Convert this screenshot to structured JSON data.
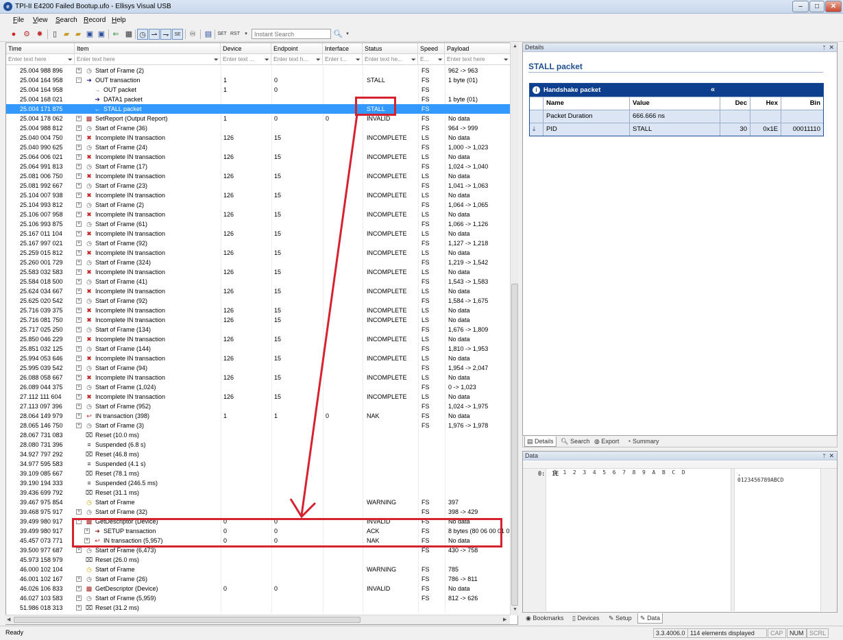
{
  "window": {
    "title": "TPI-II E4200 Failed Bootup.ufo - Ellisys Visual USB",
    "app_icon": "ellisys-logo-icon"
  },
  "menu": [
    {
      "key": "F",
      "rest": "ile"
    },
    {
      "key": "V",
      "rest": "iew"
    },
    {
      "key": "S",
      "rest": "earch"
    },
    {
      "key": "R",
      "rest": "ecord"
    },
    {
      "key": "H",
      "rest": "elp"
    }
  ],
  "toolbar": {
    "search_placeholder": "Instant Search"
  },
  "columns": {
    "time": "Time",
    "item": "Item",
    "device": "Device",
    "endpoint": "Endpoint",
    "interface": "Interface",
    "status": "Status",
    "speed": "Speed",
    "payload": "Payload"
  },
  "filters": {
    "time": "Enter text here",
    "item": "Enter text here",
    "device": "Enter text ...",
    "endpoint": "Enter text h...",
    "interface": "Enter t...",
    "status": "Enter text he...",
    "speed": "E...",
    "payload": "Enter text here"
  },
  "rows": [
    {
      "time": "25.004 988 896",
      "indent": 0,
      "exp": "+",
      "icon": "sof",
      "item": "Start of Frame (2)",
      "dev": "",
      "ep": "",
      "iface": "",
      "status": "",
      "speed": "FS",
      "payload": "962 -> 963"
    },
    {
      "time": "25.004 164 958",
      "indent": 0,
      "exp": "-",
      "icon": "out",
      "item": "OUT transaction",
      "dev": "1",
      "ep": "0",
      "iface": "",
      "status": "STALL",
      "speed": "FS",
      "payload": "1 byte (01)"
    },
    {
      "time": "25.004 164 958",
      "indent": 1,
      "exp": "",
      "icon": "outpkt",
      "item": "OUT packet",
      "dev": "1",
      "ep": "0",
      "iface": "",
      "status": "",
      "speed": "FS",
      "payload": ""
    },
    {
      "time": "25.004 168 021",
      "indent": 1,
      "exp": "",
      "icon": "data",
      "item": "DATA1 packet",
      "dev": "",
      "ep": "",
      "iface": "",
      "status": "",
      "speed": "FS",
      "payload": "1 byte (01)"
    },
    {
      "time": "25.004 171 875",
      "indent": 1,
      "exp": "",
      "icon": "stall",
      "item": "STALL packet",
      "dev": "",
      "ep": "",
      "iface": "",
      "status": "STALL",
      "speed": "FS",
      "payload": "",
      "selected": true
    },
    {
      "time": "25.004 178 062",
      "indent": 0,
      "exp": "+",
      "icon": "bad",
      "item": "SetReport (Output Report)",
      "dev": "1",
      "ep": "0",
      "iface": "0",
      "status": "INVALID",
      "speed": "FS",
      "payload": "No data"
    },
    {
      "time": "25.004 988 812",
      "indent": 0,
      "exp": "+",
      "icon": "sof",
      "item": "Start of Frame (36)",
      "dev": "",
      "ep": "",
      "iface": "",
      "status": "",
      "speed": "FS",
      "payload": "964 -> 999"
    },
    {
      "time": "25.040 004 750",
      "indent": 0,
      "exp": "+",
      "icon": "x",
      "item": "Incomplete IN transaction",
      "dev": "126",
      "ep": "15",
      "iface": "",
      "status": "INCOMPLETE",
      "speed": "LS",
      "payload": "No data"
    },
    {
      "time": "25.040 990 625",
      "indent": 0,
      "exp": "+",
      "icon": "sof",
      "item": "Start of Frame (24)",
      "dev": "",
      "ep": "",
      "iface": "",
      "status": "",
      "speed": "FS",
      "payload": "1,000 -> 1,023"
    },
    {
      "time": "25.064 006 021",
      "indent": 0,
      "exp": "+",
      "icon": "x",
      "item": "Incomplete IN transaction",
      "dev": "126",
      "ep": "15",
      "iface": "",
      "status": "INCOMPLETE",
      "speed": "LS",
      "payload": "No data"
    },
    {
      "time": "25.064 991 813",
      "indent": 0,
      "exp": "+",
      "icon": "sof",
      "item": "Start of Frame (17)",
      "dev": "",
      "ep": "",
      "iface": "",
      "status": "",
      "speed": "FS",
      "payload": "1,024 -> 1,040"
    },
    {
      "time": "25.081 006 750",
      "indent": 0,
      "exp": "+",
      "icon": "x",
      "item": "Incomplete IN transaction",
      "dev": "126",
      "ep": "15",
      "iface": "",
      "status": "INCOMPLETE",
      "speed": "LS",
      "payload": "No data"
    },
    {
      "time": "25.081 992 667",
      "indent": 0,
      "exp": "+",
      "icon": "sof",
      "item": "Start of Frame (23)",
      "dev": "",
      "ep": "",
      "iface": "",
      "status": "",
      "speed": "FS",
      "payload": "1,041 -> 1,063"
    },
    {
      "time": "25.104 007 938",
      "indent": 0,
      "exp": "+",
      "icon": "x",
      "item": "Incomplete IN transaction",
      "dev": "126",
      "ep": "15",
      "iface": "",
      "status": "INCOMPLETE",
      "speed": "LS",
      "payload": "No data"
    },
    {
      "time": "25.104 993 812",
      "indent": 0,
      "exp": "+",
      "icon": "sof",
      "item": "Start of Frame (2)",
      "dev": "",
      "ep": "",
      "iface": "",
      "status": "",
      "speed": "FS",
      "payload": "1,064 -> 1,065"
    },
    {
      "time": "25.106 007 958",
      "indent": 0,
      "exp": "+",
      "icon": "x",
      "item": "Incomplete IN transaction",
      "dev": "126",
      "ep": "15",
      "iface": "",
      "status": "INCOMPLETE",
      "speed": "LS",
      "payload": "No data"
    },
    {
      "time": "25.106 993 875",
      "indent": 0,
      "exp": "+",
      "icon": "sof",
      "item": "Start of Frame (61)",
      "dev": "",
      "ep": "",
      "iface": "",
      "status": "",
      "speed": "FS",
      "payload": "1,066 -> 1,126"
    },
    {
      "time": "25.167 011 104",
      "indent": 0,
      "exp": "+",
      "icon": "x",
      "item": "Incomplete IN transaction",
      "dev": "126",
      "ep": "15",
      "iface": "",
      "status": "INCOMPLETE",
      "speed": "LS",
      "payload": "No data"
    },
    {
      "time": "25.167 997 021",
      "indent": 0,
      "exp": "+",
      "icon": "sof",
      "item": "Start of Frame (92)",
      "dev": "",
      "ep": "",
      "iface": "",
      "status": "",
      "speed": "FS",
      "payload": "1,127 -> 1,218"
    },
    {
      "time": "25.259 015 812",
      "indent": 0,
      "exp": "+",
      "icon": "x",
      "item": "Incomplete IN transaction",
      "dev": "126",
      "ep": "15",
      "iface": "",
      "status": "INCOMPLETE",
      "speed": "LS",
      "payload": "No data"
    },
    {
      "time": "25.260 001 729",
      "indent": 0,
      "exp": "+",
      "icon": "sof",
      "item": "Start of Frame (324)",
      "dev": "",
      "ep": "",
      "iface": "",
      "status": "",
      "speed": "FS",
      "payload": "1,219 -> 1,542"
    },
    {
      "time": "25.583 032 583",
      "indent": 0,
      "exp": "+",
      "icon": "x",
      "item": "Incomplete IN transaction",
      "dev": "126",
      "ep": "15",
      "iface": "",
      "status": "INCOMPLETE",
      "speed": "LS",
      "payload": "No data"
    },
    {
      "time": "25.584 018 500",
      "indent": 0,
      "exp": "+",
      "icon": "sof",
      "item": "Start of Frame (41)",
      "dev": "",
      "ep": "",
      "iface": "",
      "status": "",
      "speed": "FS",
      "payload": "1,543 -> 1,583"
    },
    {
      "time": "25.624 034 667",
      "indent": 0,
      "exp": "+",
      "icon": "x",
      "item": "Incomplete IN transaction",
      "dev": "126",
      "ep": "15",
      "iface": "",
      "status": "INCOMPLETE",
      "speed": "LS",
      "payload": "No data"
    },
    {
      "time": "25.625 020 542",
      "indent": 0,
      "exp": "+",
      "icon": "sof",
      "item": "Start of Frame (92)",
      "dev": "",
      "ep": "",
      "iface": "",
      "status": "",
      "speed": "FS",
      "payload": "1,584 -> 1,675"
    },
    {
      "time": "25.716 039 375",
      "indent": 0,
      "exp": "+",
      "icon": "x",
      "item": "Incomplete IN transaction",
      "dev": "126",
      "ep": "15",
      "iface": "",
      "status": "INCOMPLETE",
      "speed": "LS",
      "payload": "No data"
    },
    {
      "time": "25.716 081 750",
      "indent": 0,
      "exp": "+",
      "icon": "x",
      "item": "Incomplete IN transaction",
      "dev": "126",
      "ep": "15",
      "iface": "",
      "status": "INCOMPLETE",
      "speed": "LS",
      "payload": "No data"
    },
    {
      "time": "25.717 025 250",
      "indent": 0,
      "exp": "+",
      "icon": "sof",
      "item": "Start of Frame (134)",
      "dev": "",
      "ep": "",
      "iface": "",
      "status": "",
      "speed": "FS",
      "payload": "1,676 -> 1,809"
    },
    {
      "time": "25.850 046 229",
      "indent": 0,
      "exp": "+",
      "icon": "x",
      "item": "Incomplete IN transaction",
      "dev": "126",
      "ep": "15",
      "iface": "",
      "status": "INCOMPLETE",
      "speed": "LS",
      "payload": "No data"
    },
    {
      "time": "25.851 032 125",
      "indent": 0,
      "exp": "+",
      "icon": "sof",
      "item": "Start of Frame (144)",
      "dev": "",
      "ep": "",
      "iface": "",
      "status": "",
      "speed": "FS",
      "payload": "1,810 -> 1,953"
    },
    {
      "time": "25.994 053 646",
      "indent": 0,
      "exp": "+",
      "icon": "x",
      "item": "Incomplete IN transaction",
      "dev": "126",
      "ep": "15",
      "iface": "",
      "status": "INCOMPLETE",
      "speed": "LS",
      "payload": "No data"
    },
    {
      "time": "25.995 039 542",
      "indent": 0,
      "exp": "+",
      "icon": "sof",
      "item": "Start of Frame (94)",
      "dev": "",
      "ep": "",
      "iface": "",
      "status": "",
      "speed": "FS",
      "payload": "1,954 -> 2,047"
    },
    {
      "time": "26.088 058 667",
      "indent": 0,
      "exp": "+",
      "icon": "x",
      "item": "Incomplete IN transaction",
      "dev": "126",
      "ep": "15",
      "iface": "",
      "status": "INCOMPLETE",
      "speed": "LS",
      "payload": "No data"
    },
    {
      "time": "26.089 044 375",
      "indent": 0,
      "exp": "+",
      "icon": "sof",
      "item": "Start of Frame (1,024)",
      "dev": "",
      "ep": "",
      "iface": "",
      "status": "",
      "speed": "FS",
      "payload": "0 -> 1,023"
    },
    {
      "time": "27.112 111 604",
      "indent": 0,
      "exp": "+",
      "icon": "x",
      "item": "Incomplete IN transaction",
      "dev": "126",
      "ep": "15",
      "iface": "",
      "status": "INCOMPLETE",
      "speed": "LS",
      "payload": "No data"
    },
    {
      "time": "27.113 097 396",
      "indent": 0,
      "exp": "+",
      "icon": "sof",
      "item": "Start of Frame (952)",
      "dev": "",
      "ep": "",
      "iface": "",
      "status": "",
      "speed": "FS",
      "payload": "1,024 -> 1,975"
    },
    {
      "time": "28.064 149 979",
      "indent": 0,
      "exp": "+",
      "icon": "in",
      "item": "IN transaction (398)",
      "dev": "1",
      "ep": "1",
      "iface": "0",
      "status": "NAK",
      "speed": "FS",
      "payload": "No data"
    },
    {
      "time": "28.065 146 750",
      "indent": 0,
      "exp": "+",
      "icon": "sof",
      "item": "Start of Frame (3)",
      "dev": "",
      "ep": "",
      "iface": "",
      "status": "",
      "speed": "FS",
      "payload": "1,976 -> 1,978"
    },
    {
      "time": "28.067 731 083",
      "indent": 0,
      "exp": "",
      "icon": "reset",
      "item": "Reset (10.0 ms)",
      "dev": "",
      "ep": "",
      "iface": "",
      "status": "",
      "speed": "",
      "payload": ""
    },
    {
      "time": "28.080 731 396",
      "indent": 0,
      "exp": "",
      "icon": "idle",
      "item": "Suspended (6.8 s)",
      "dev": "",
      "ep": "",
      "iface": "",
      "status": "",
      "speed": "",
      "payload": ""
    },
    {
      "time": "34.927 797 292",
      "indent": 0,
      "exp": "",
      "icon": "reset",
      "item": "Reset (46.8 ms)",
      "dev": "",
      "ep": "",
      "iface": "",
      "status": "",
      "speed": "",
      "payload": ""
    },
    {
      "time": "34.977 595 583",
      "indent": 0,
      "exp": "",
      "icon": "idle",
      "item": "Suspended (4.1 s)",
      "dev": "",
      "ep": "",
      "iface": "",
      "status": "",
      "speed": "",
      "payload": ""
    },
    {
      "time": "39.109 085 667",
      "indent": 0,
      "exp": "",
      "icon": "reset",
      "item": "Reset (78.1 ms)",
      "dev": "",
      "ep": "",
      "iface": "",
      "status": "",
      "speed": "",
      "payload": ""
    },
    {
      "time": "39.190 194 333",
      "indent": 0,
      "exp": "",
      "icon": "idle",
      "item": "Suspended (246.5 ms)",
      "dev": "",
      "ep": "",
      "iface": "",
      "status": "",
      "speed": "",
      "payload": ""
    },
    {
      "time": "39.436 699 792",
      "indent": 0,
      "exp": "",
      "icon": "reset",
      "item": "Reset (31.1 ms)",
      "dev": "",
      "ep": "",
      "iface": "",
      "status": "",
      "speed": "",
      "payload": ""
    },
    {
      "time": "39.467 975 854",
      "indent": 0,
      "exp": "",
      "icon": "sofwarn",
      "item": "Start of Frame",
      "dev": "",
      "ep": "",
      "iface": "",
      "status": "WARNING",
      "speed": "FS",
      "payload": "397"
    },
    {
      "time": "39.468 975 917",
      "indent": 0,
      "exp": "+",
      "icon": "sof",
      "item": "Start of Frame (32)",
      "dev": "",
      "ep": "",
      "iface": "",
      "status": "",
      "speed": "FS",
      "payload": "398 -> 429"
    },
    {
      "time": "39.499 980 917",
      "indent": 0,
      "exp": "-",
      "icon": "bad",
      "item": "GetDescriptor (Device)",
      "dev": "0",
      "ep": "0",
      "iface": "",
      "status": "INVALID",
      "speed": "FS",
      "payload": "No data"
    },
    {
      "time": "39.499 980 917",
      "indent": 1,
      "exp": "+",
      "icon": "setup",
      "item": "SETUP transaction",
      "dev": "0",
      "ep": "0",
      "iface": "",
      "status": "ACK",
      "speed": "FS",
      "payload": "8 bytes (80 06 00 01 00"
    },
    {
      "time": "45.457 073 771",
      "indent": 1,
      "exp": "+",
      "icon": "in",
      "item": "IN transaction (5,957)",
      "dev": "0",
      "ep": "0",
      "iface": "",
      "status": "NAK",
      "speed": "FS",
      "payload": "No data"
    },
    {
      "time": "39.500 977 687",
      "indent": 0,
      "exp": "+",
      "icon": "sof",
      "item": "Start of Frame (6,473)",
      "dev": "",
      "ep": "",
      "iface": "",
      "status": "",
      "speed": "FS",
      "payload": "430 -> 758"
    },
    {
      "time": "45.973 158 979",
      "indent": 0,
      "exp": "",
      "icon": "reset",
      "item": "Reset (26.0 ms)",
      "dev": "",
      "ep": "",
      "iface": "",
      "status": "",
      "speed": "",
      "payload": ""
    },
    {
      "time": "46.000 102 104",
      "indent": 0,
      "exp": "",
      "icon": "sofwarn",
      "item": "Start of Frame",
      "dev": "",
      "ep": "",
      "iface": "",
      "status": "WARNING",
      "speed": "FS",
      "payload": "785"
    },
    {
      "time": "46.001 102 167",
      "indent": 0,
      "exp": "+",
      "icon": "sof",
      "item": "Start of Frame (26)",
      "dev": "",
      "ep": "",
      "iface": "",
      "status": "",
      "speed": "FS",
      "payload": "786 -> 811"
    },
    {
      "time": "46.026 106 833",
      "indent": 0,
      "exp": "+",
      "icon": "bad",
      "item": "GetDescriptor (Device)",
      "dev": "0",
      "ep": "0",
      "iface": "",
      "status": "INVALID",
      "speed": "FS",
      "payload": "No data"
    },
    {
      "time": "46.027 103 583",
      "indent": 0,
      "exp": "+",
      "icon": "sof",
      "item": "Start of Frame (5,959)",
      "dev": "",
      "ep": "",
      "iface": "",
      "status": "",
      "speed": "FS",
      "payload": "812 -> 626"
    },
    {
      "time": "51.986 018 313",
      "indent": 0,
      "exp": "+",
      "icon": "reset",
      "item": "Reset (31.2 ms)",
      "dev": "",
      "ep": "",
      "iface": "",
      "status": "",
      "speed": "",
      "payload": ""
    }
  ],
  "details": {
    "header": "Details",
    "title": "STALL packet",
    "table_title": "Handshake packet",
    "collapse_glyph": "«",
    "col_name": "Name",
    "col_value": "Value",
    "col_dec": "Dec",
    "col_hex": "Hex",
    "col_bin": "Bin",
    "rows": [
      {
        "name": "Packet Duration",
        "value": "666.666 ns",
        "dec": "",
        "hex": "",
        "bin": ""
      },
      {
        "name": "PID",
        "value": "STALL",
        "dec": "30",
        "hex": "0x1E",
        "bin": "00011110"
      }
    ],
    "tabs": [
      "Details",
      "Search",
      "Export",
      "Summary"
    ]
  },
  "data_panel": {
    "header": "Data",
    "hex_header": "0  1  2  3  4  5  6  7  8  9  A  B  C  D",
    "ascii_header": "0123456789ABCD",
    "offset": "0:",
    "bytes": "1E",
    "ascii": ".",
    "tabs": [
      "Bookmarks",
      "Devices",
      "Setup",
      "Data"
    ]
  },
  "status": {
    "ready": "Ready",
    "version": "3.3.4006.0",
    "elements": "114 elements displayed",
    "cap": "CAP",
    "num": "NUM",
    "scrl": "SCRL"
  }
}
